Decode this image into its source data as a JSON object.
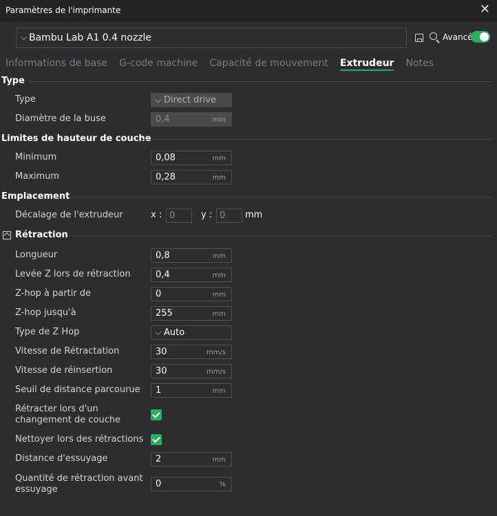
{
  "window": {
    "title": "Paramètres de l'imprimante",
    "close": "✕"
  },
  "preset": {
    "value": "Bambu Lab A1 0.4 nozzle"
  },
  "toolbar": {
    "advanced_label": "Avancé",
    "advanced_on": true
  },
  "tabs": [
    {
      "label": "Informations de base",
      "active": false
    },
    {
      "label": "G-code machine",
      "active": false
    },
    {
      "label": "Capacité de mouvement",
      "active": false
    },
    {
      "label": "Extrudeur",
      "active": true
    },
    {
      "label": "Notes",
      "active": false
    }
  ],
  "sections": {
    "type": {
      "title": "Type",
      "type_label": "Type",
      "type_value": "Direct drive",
      "nozzle_label": "Diamètre de la buse",
      "nozzle_value": "0,4",
      "nozzle_unit": "mm"
    },
    "layer": {
      "title": "Limites de hauteur de couche",
      "min_label": "Minimum",
      "min_value": "0,08",
      "min_unit": "mm",
      "max_label": "Maximum",
      "max_value": "0,28",
      "max_unit": "mm"
    },
    "position": {
      "title": "Emplacement",
      "offset_label": "Décalage de l'extrudeur",
      "x_label": "x :",
      "x_value": "0",
      "y_label": "y :",
      "y_value": "0",
      "unit": "mm"
    },
    "retraction": {
      "title": "Rétraction",
      "rows": [
        {
          "label": "Longueur",
          "value": "0,8",
          "unit": "mm"
        },
        {
          "label": "Levée Z lors de rétraction",
          "value": "0,4",
          "unit": "mm"
        },
        {
          "label": "Z-hop à partir de",
          "value": "0",
          "unit": "mm"
        },
        {
          "label": "Z-hop jusqu'à",
          "value": "255",
          "unit": "mm"
        },
        {
          "label": "Type de Z Hop",
          "value": "Auto"
        },
        {
          "label": "Vitesse de Rétractation",
          "value": "30",
          "unit": "mm/s"
        },
        {
          "label": "Vitesse de réinsertion",
          "value": "30",
          "unit": "mm/s"
        },
        {
          "label": "Seuil de distance parcourue",
          "value": "1",
          "unit": "mm"
        },
        {
          "label_line1": "Rétracter lors d'un",
          "label_line2": "changement de couche",
          "checked": true
        },
        {
          "label": "Nettoyer lors des rétractions",
          "checked": true
        },
        {
          "label": "Distance d'essuyage",
          "value": "2",
          "unit": "mm"
        },
        {
          "label_line1": "Quantité de rétraction avant",
          "label_line2": "essuyage",
          "value": "0",
          "unit": "%"
        }
      ]
    }
  },
  "colors": {
    "accent": "#27ae60",
    "background": "#2d2d31",
    "titlebar": "#242427"
  }
}
